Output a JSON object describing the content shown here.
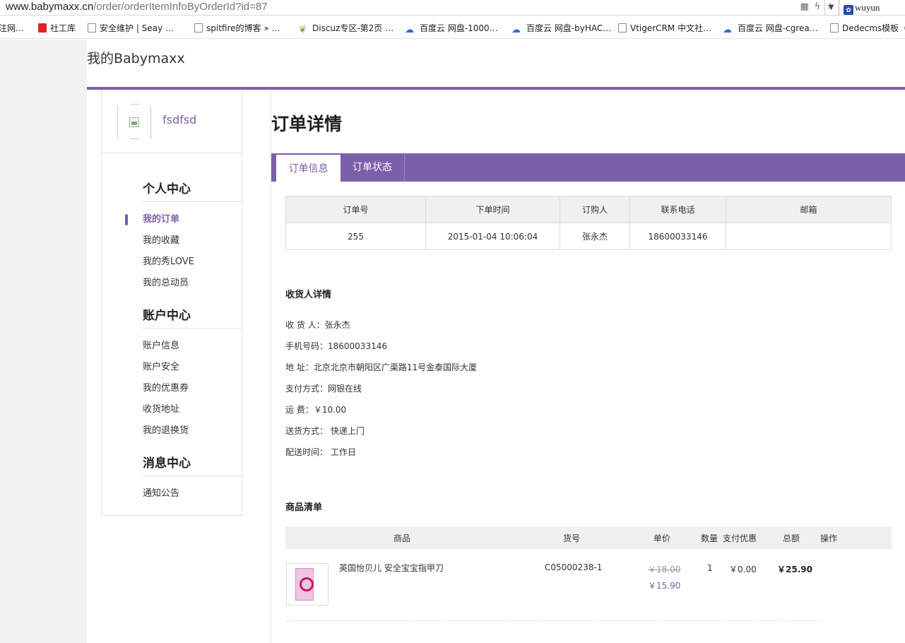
{
  "browser": {
    "url_host": "www.babymaxx.cn",
    "url_path": "/order/orderItemInfoByOrderId?id=87",
    "profile_name": "wuyun",
    "bookmarks": [
      "注网…",
      "社工库",
      "安全维护 | Seay …",
      "spitfire的博客 » …",
      "Discuz专区-第2页 …",
      "百度云 网盘-1000…",
      "百度云 网盘-byHAC…",
      "VtigerCRM 中文社…",
      "百度云 网盘-cgrea…",
      "Dedecms模板（织"
    ]
  },
  "site": {
    "title": "我的Babymaxx"
  },
  "sidebar": {
    "username": "fsdfsd",
    "groups": [
      {
        "title": "个人中心",
        "items": [
          "我的订单",
          "我的收藏",
          "我的秀LOVE",
          "我的总动员"
        ]
      },
      {
        "title": "账户中心",
        "items": [
          "账户信息",
          "账户安全",
          "我的优惠券",
          "收货地址",
          "我的退换货"
        ]
      },
      {
        "title": "消息中心",
        "items": [
          "通知公告"
        ]
      }
    ]
  },
  "main": {
    "title": "订单详情",
    "tabs": [
      "订单信息",
      "订单状态"
    ],
    "order_table": {
      "headers": [
        "订单号",
        "下单时间",
        "订购人",
        "联系电话",
        "邮箱"
      ],
      "row": [
        "255",
        "2015-01-04 10:06:04",
        "张永杰",
        "18600033146",
        ""
      ]
    },
    "receiver_title": "收货人详情",
    "receiver": [
      "收  货  人：张永杰",
      "手机号码：18600033146",
      "地        址：北京北京市朝阳区广渠路11号金泰国际大厦",
      "支付方式：网银在线",
      "运        费：￥10.00",
      "送货方式： 快递上门",
      "配送时间： 工作日"
    ],
    "goods_title": "商品清单",
    "goods_headers": [
      "商品",
      "货号",
      "单价",
      "数量",
      "支付优惠",
      "总额",
      "操作"
    ],
    "goods": [
      {
        "name": "英国怡贝儿 安全宝宝指甲刀",
        "sku": "C05000238-1",
        "original_price": "￥18.00",
        "price": "￥15.90",
        "quantity": "1",
        "discount": "￥0.00",
        "total": "￥25.90"
      }
    ]
  },
  "colors": {
    "accent": "#7b5faa"
  }
}
